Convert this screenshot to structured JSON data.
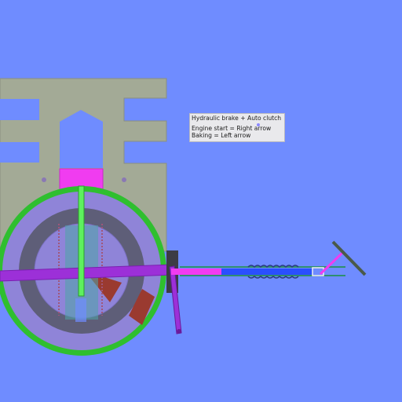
{
  "info": {
    "title": "Hydraulic brake + Auto clutch",
    "line1": "Engine start = Right arrow",
    "line2": "Baking = Left arrow"
  },
  "colors": {
    "background": "#6f8cff",
    "frame": "#a3aa96",
    "outer_ring": "#2fbf2f",
    "disc_light": "#8f84d8",
    "disc_dark": "#5e5e78",
    "brake_pad": "#9a3a30",
    "clutch_pink": "#f03cf0",
    "piston_blue": "#2a4fff",
    "purple_arm": "#9c30d8",
    "green_rod": "#5ef05e"
  }
}
